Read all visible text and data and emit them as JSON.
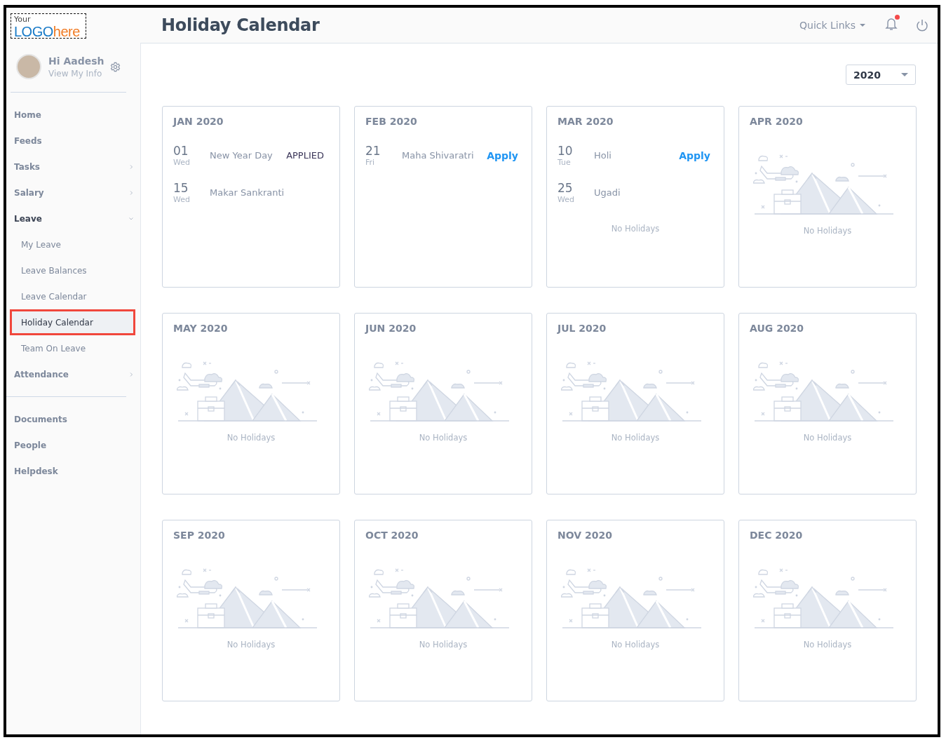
{
  "header": {
    "logo": {
      "top": "Your",
      "main": "LOGO",
      "accent": "here"
    },
    "title": "Holiday Calendar",
    "quick_links": "Quick Links",
    "notification_dot": true
  },
  "profile": {
    "greeting": "Hi Aadesh",
    "link": "View My Info"
  },
  "sidebar": {
    "groups": [
      {
        "items": [
          {
            "label": "Home",
            "kind": "top",
            "selected": false
          },
          {
            "label": "Feeds",
            "kind": "top",
            "selected": false
          },
          {
            "label": "Tasks",
            "kind": "top",
            "selected": false,
            "expanded": false
          },
          {
            "label": "Salary",
            "kind": "top",
            "selected": false,
            "expanded": false
          },
          {
            "label": "Leave",
            "kind": "top",
            "selected": false,
            "expanded": true,
            "children": [
              {
                "label": "My Leave",
                "kind": "sub",
                "selected": false
              },
              {
                "label": "Leave Balances",
                "kind": "sub",
                "selected": false
              },
              {
                "label": "Leave Calendar",
                "kind": "sub",
                "selected": false
              },
              {
                "label": "Holiday Calendar",
                "kind": "sub",
                "selected": true
              },
              {
                "label": "Team On Leave",
                "kind": "sub",
                "selected": false
              }
            ]
          },
          {
            "label": "Attendance",
            "kind": "top",
            "selected": false,
            "expanded": false
          }
        ]
      },
      {
        "items": [
          {
            "label": "Documents",
            "kind": "top",
            "selected": false
          },
          {
            "label": "People",
            "kind": "top",
            "selected": false
          },
          {
            "label": "Helpdesk",
            "kind": "top",
            "selected": false
          }
        ]
      }
    ]
  },
  "year_select": {
    "value": "2020"
  },
  "months": [
    {
      "title": "JAN 2020",
      "holidays": [
        {
          "day": "01",
          "weekday": "Wed",
          "name": "New Year Day",
          "action": {
            "kind": "applied",
            "label": "APPLIED"
          }
        },
        {
          "day": "15",
          "weekday": "Wed",
          "name": "Makar Sankranti"
        }
      ]
    },
    {
      "title": "FEB 2020",
      "holidays": [
        {
          "day": "21",
          "weekday": "Fri",
          "name": "Maha Shivaratri",
          "action": {
            "kind": "apply",
            "label": "Apply"
          }
        }
      ]
    },
    {
      "title": "MAR 2020",
      "holidays": [
        {
          "day": "10",
          "weekday": "Tue",
          "name": "Holi",
          "action": {
            "kind": "apply",
            "label": "Apply"
          }
        },
        {
          "day": "25",
          "weekday": "Wed",
          "name": "Ugadi"
        }
      ],
      "empty_text": "No Holidays",
      "illustration": false
    },
    {
      "title": "APR 2020",
      "empty_text": "No Holidays",
      "illustration": true
    },
    {
      "title": "MAY 2020",
      "empty_text": "No Holidays",
      "illustration": true
    },
    {
      "title": "JUN 2020",
      "empty_text": "No Holidays",
      "illustration": true
    },
    {
      "title": "JUL 2020",
      "empty_text": "No Holidays",
      "illustration": true
    },
    {
      "title": "AUG 2020",
      "empty_text": "No Holidays",
      "illustration": true
    },
    {
      "title": "SEP 2020",
      "empty_text": "No Holidays",
      "illustration": true
    },
    {
      "title": "OCT 2020",
      "empty_text": "No Holidays",
      "illustration": true
    },
    {
      "title": "NOV 2020",
      "empty_text": "No Holidays",
      "illustration": true
    },
    {
      "title": "DEC 2020",
      "empty_text": "No Holidays",
      "illustration": true
    }
  ]
}
